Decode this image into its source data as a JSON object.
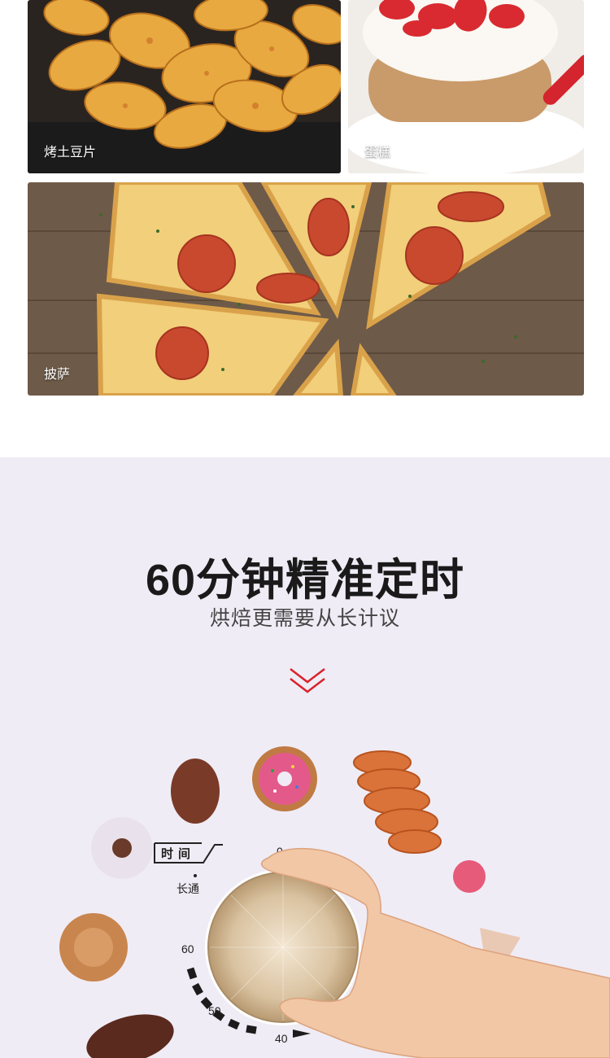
{
  "food_gallery": {
    "items": [
      {
        "caption": "烤土豆片"
      },
      {
        "caption": "蛋糕"
      },
      {
        "caption": "披萨"
      }
    ]
  },
  "timer": {
    "title": "60分钟精准定时",
    "subtitle": "烘焙更需要从长计议",
    "accent_color": "#d9222a",
    "dial": {
      "label": "时间",
      "always_on": "长通",
      "marks": [
        "0",
        "60",
        "50",
        "40"
      ]
    }
  }
}
